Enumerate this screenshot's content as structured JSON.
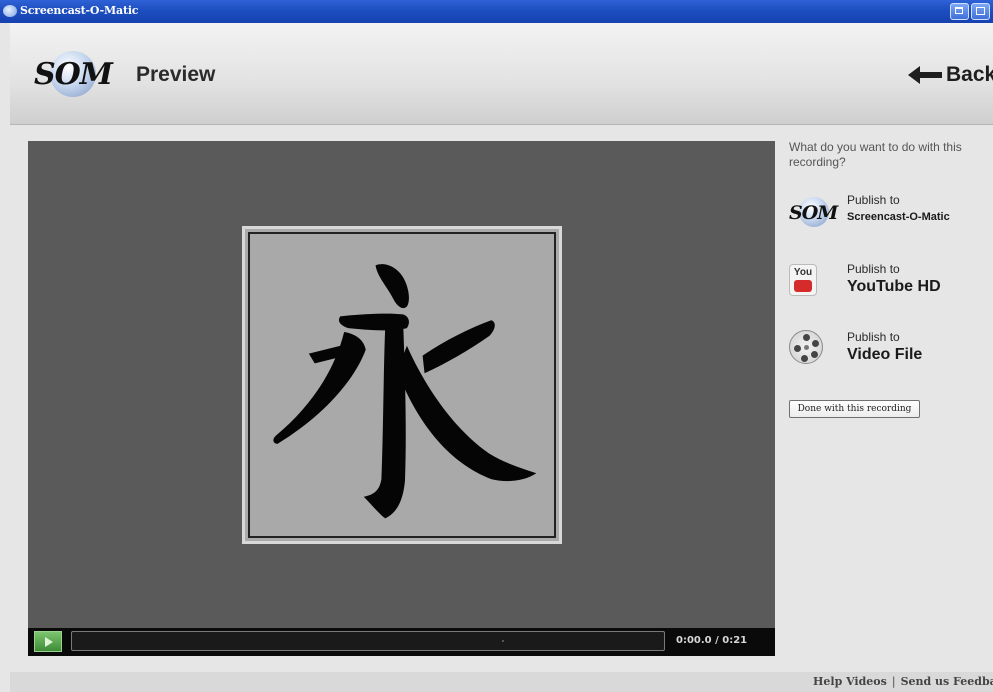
{
  "window": {
    "title": "Screencast-O-Matic"
  },
  "header": {
    "logo_text": "SOM",
    "page_title": "Preview",
    "back_label": "Back"
  },
  "player": {
    "displayed_character": "永",
    "time_display": "0:00.0 / 0:21",
    "progress_fraction": 0.0
  },
  "side_panel": {
    "question": "What do you want to do with this recording?",
    "publish_options": [
      {
        "prefix": "Publish to",
        "name": "Screencast-O-Matic",
        "icon": "som-logo-icon"
      },
      {
        "prefix": "Publish to",
        "name": "YouTube HD",
        "icon": "youtube-icon"
      },
      {
        "prefix": "Publish to",
        "name": "Video File",
        "icon": "film-reel-icon"
      }
    ],
    "done_label": "Done with this recording",
    "youtube_icon_text": "You"
  },
  "footer": {
    "help_videos": "Help Videos",
    "separator": "|",
    "send_feedback": "Send us Feedback"
  },
  "colors": {
    "titlebar": "#1d4ec0",
    "player_background": "#5a5a5a",
    "frame_background": "#aaaaaa",
    "controls_background": "#0a0a0a",
    "play_button": "#4f9f45"
  }
}
